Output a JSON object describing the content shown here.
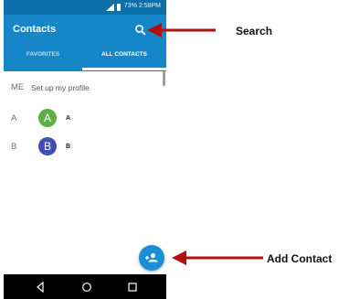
{
  "status_bar": {
    "battery_time": "73% 2:58PM"
  },
  "app_bar": {
    "title": "Contacts"
  },
  "tabs": [
    {
      "label": "FAVORITES"
    },
    {
      "label": "ALL CONTACTS"
    }
  ],
  "me_row": {
    "section": "ME",
    "text": "Set up my profile"
  },
  "contacts": [
    {
      "section": "A",
      "initial": "A",
      "name": "A",
      "avatar_color": "#5fae43"
    },
    {
      "section": "B",
      "initial": "B",
      "name": "B",
      "avatar_color": "#3f51b5"
    }
  ],
  "callouts": {
    "search": "Search",
    "add_contact": "Add Contact"
  },
  "colors": {
    "primary": "#1587c9",
    "status_bar": "#0c6fa8",
    "fab": "#1a8fd8",
    "arrow": "#b01010"
  },
  "icons": {
    "search": "search-icon",
    "add_contact": "add-contact-icon",
    "back": "back-icon",
    "home": "home-icon",
    "recents": "recents-icon"
  }
}
